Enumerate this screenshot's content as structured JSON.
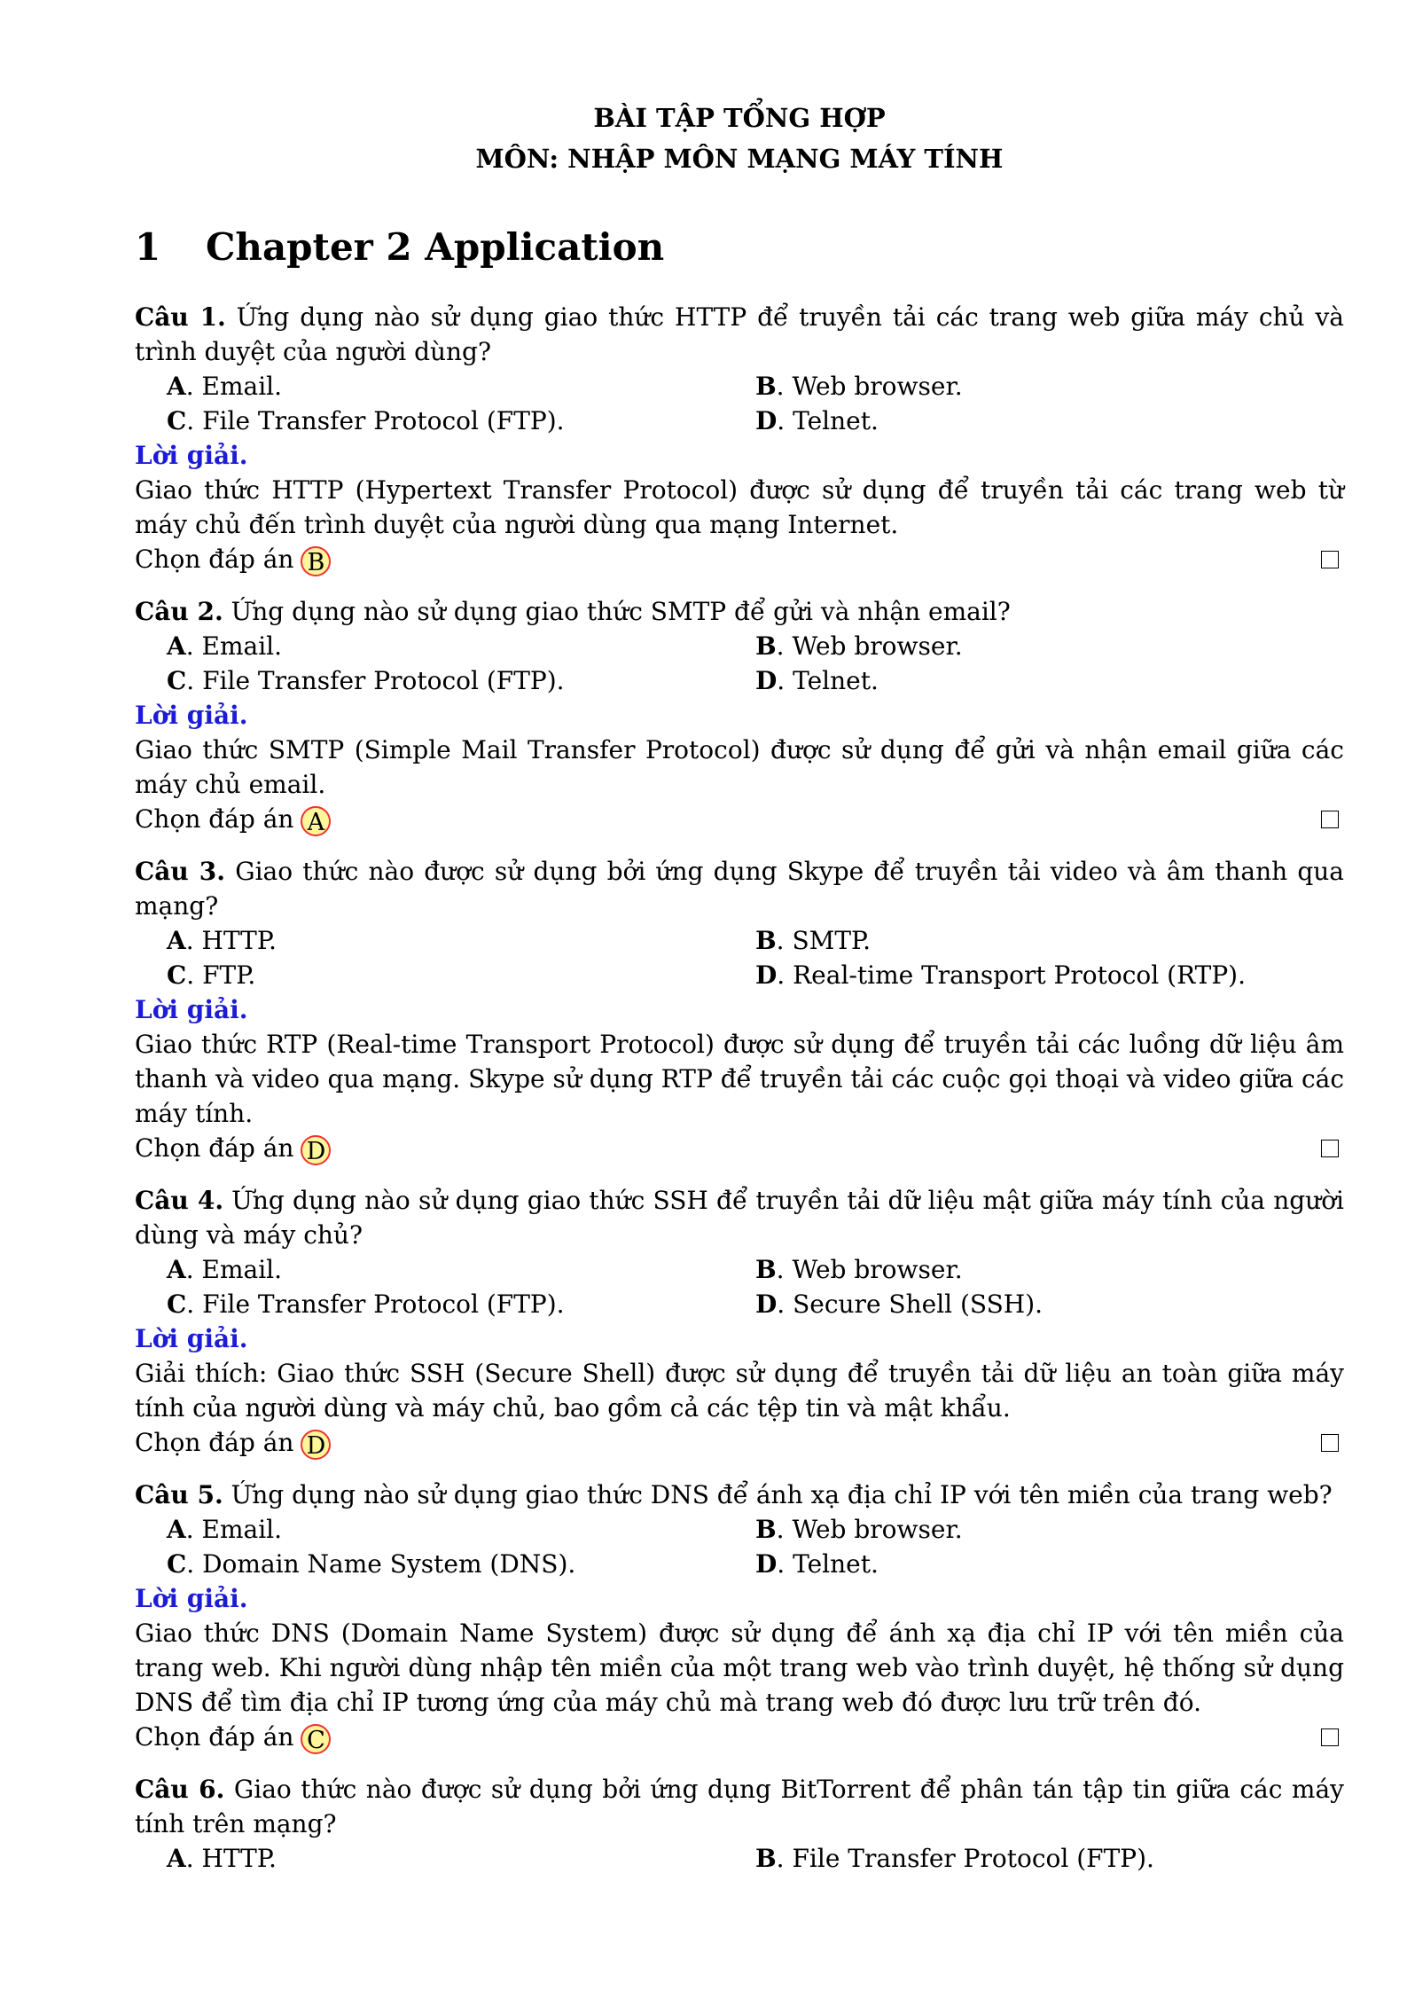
{
  "title_line1": "BÀI TẬP TỔNG HỢP",
  "title_line2": "MÔN: NHẬP MÔN MẠNG MÁY TÍNH",
  "section": {
    "number": "1",
    "title": "Chapter 2 Application"
  },
  "solution_label": "Lời giải.",
  "answer_prefix": "Chọn đáp án",
  "questions": [
    {
      "label": "Câu 1.",
      "text": "Ứng dụng nào sử dụng giao thức HTTP để truyền tải các trang web giữa máy chủ và trình duyệt của người dùng?",
      "options": [
        {
          "letter": "A",
          "text": "Email."
        },
        {
          "letter": "B",
          "text": "Web browser."
        },
        {
          "letter": "C",
          "text": "File Transfer Protocol (FTP)."
        },
        {
          "letter": "D",
          "text": "Telnet."
        }
      ],
      "explanation": "Giao thức HTTP (Hypertext Transfer Protocol) được sử dụng để truyền tải các trang web từ máy chủ đến trình duyệt của người dùng qua mạng Internet.",
      "answer": "B"
    },
    {
      "label": "Câu 2.",
      "text": "Ứng dụng nào sử dụng giao thức SMTP để gửi và nhận email?",
      "options": [
        {
          "letter": "A",
          "text": "Email."
        },
        {
          "letter": "B",
          "text": "Web browser."
        },
        {
          "letter": "C",
          "text": "File Transfer Protocol (FTP)."
        },
        {
          "letter": "D",
          "text": "Telnet."
        }
      ],
      "explanation": "Giao thức SMTP (Simple Mail Transfer Protocol) được sử dụng để gửi và nhận email giữa các máy chủ email.",
      "answer": "A"
    },
    {
      "label": "Câu 3.",
      "text": "Giao thức nào được sử dụng bởi ứng dụng Skype để truyền tải video và âm thanh qua mạng?",
      "options": [
        {
          "letter": "A",
          "text": "HTTP."
        },
        {
          "letter": "B",
          "text": "SMTP."
        },
        {
          "letter": "C",
          "text": "FTP."
        },
        {
          "letter": "D",
          "text": "Real-time Transport Protocol (RTP)."
        }
      ],
      "explanation": "Giao thức RTP (Real-time Transport Protocol) được sử dụng để truyền tải các luồng dữ liệu âm thanh và video qua mạng. Skype sử dụng RTP để truyền tải các cuộc gọi thoại và video giữa các máy tính.",
      "answer": "D"
    },
    {
      "label": "Câu 4.",
      "text": "Ứng dụng nào sử dụng giao thức SSH để truyền tải dữ liệu mật giữa máy tính của người dùng và máy chủ?",
      "options": [
        {
          "letter": "A",
          "text": "Email."
        },
        {
          "letter": "B",
          "text": "Web browser."
        },
        {
          "letter": "C",
          "text": "File Transfer Protocol (FTP)."
        },
        {
          "letter": "D",
          "text": "Secure Shell (SSH)."
        }
      ],
      "explanation": "Giải thích: Giao thức SSH (Secure Shell) được sử dụng để truyền tải dữ liệu an toàn giữa máy tính của người dùng và máy chủ, bao gồm cả các tệp tin và mật khẩu.",
      "answer": "D"
    },
    {
      "label": "Câu 5.",
      "text": "Ứng dụng nào sử dụng giao thức DNS để ánh xạ địa chỉ IP với tên miền của trang web?",
      "options": [
        {
          "letter": "A",
          "text": "Email."
        },
        {
          "letter": "B",
          "text": "Web browser."
        },
        {
          "letter": "C",
          "text": "Domain Name System (DNS)."
        },
        {
          "letter": "D",
          "text": "Telnet."
        }
      ],
      "explanation": "Giao thức DNS (Domain Name System) được sử dụng để ánh xạ địa chỉ IP với tên miền của trang web. Khi người dùng nhập tên miền của một trang web vào trình duyệt, hệ thống sử dụng DNS để tìm địa chỉ IP tương ứng của máy chủ mà trang web đó được lưu trữ trên đó.",
      "answer": "C"
    },
    {
      "label": "Câu 6.",
      "text": "Giao thức nào được sử dụng bởi ứng dụng BitTorrent để phân tán tập tin giữa các máy tính trên mạng?",
      "options": [
        {
          "letter": "A",
          "text": "HTTP."
        },
        {
          "letter": "B",
          "text": "File Transfer Protocol (FTP)."
        }
      ]
    }
  ]
}
